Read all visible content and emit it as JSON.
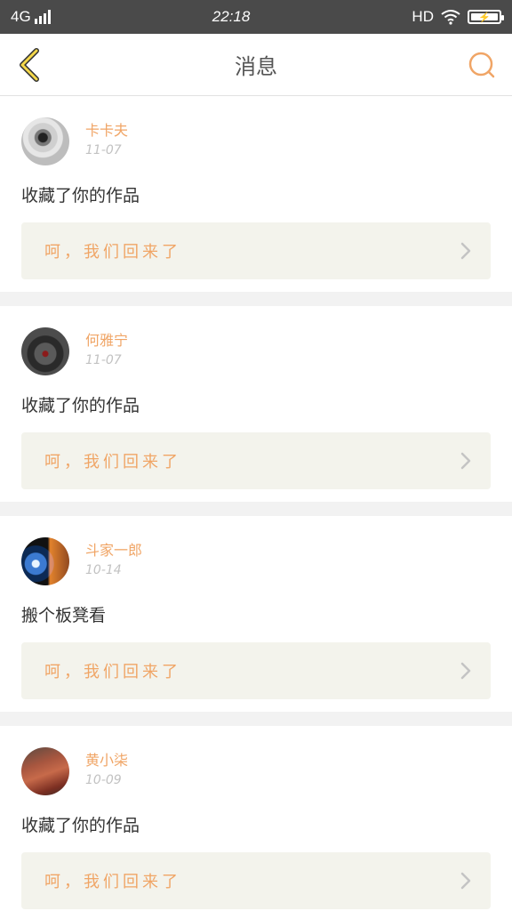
{
  "status_bar": {
    "network": "4G",
    "time": "22:18",
    "hd": "HD"
  },
  "header": {
    "title": "消息",
    "back_icon": "chevron-left-icon",
    "search_icon": "search-icon",
    "accent": "#f5c518",
    "search_color": "#f0a566"
  },
  "messages": [
    {
      "name": "卡卡夫",
      "date": "11-07",
      "text": "收藏了你的作品",
      "quote": "呵，我们回来了"
    },
    {
      "name": "何雅宁",
      "date": "11-07",
      "text": "收藏了你的作品",
      "quote": "呵，我们回来了"
    },
    {
      "name": "斗家一郎",
      "date": "10-14",
      "text": "搬个板凳看",
      "quote": "呵，我们回来了"
    },
    {
      "name": "黄小柒",
      "date": "10-09",
      "text": "收藏了你的作品",
      "quote": "呵，我们回来了"
    }
  ]
}
